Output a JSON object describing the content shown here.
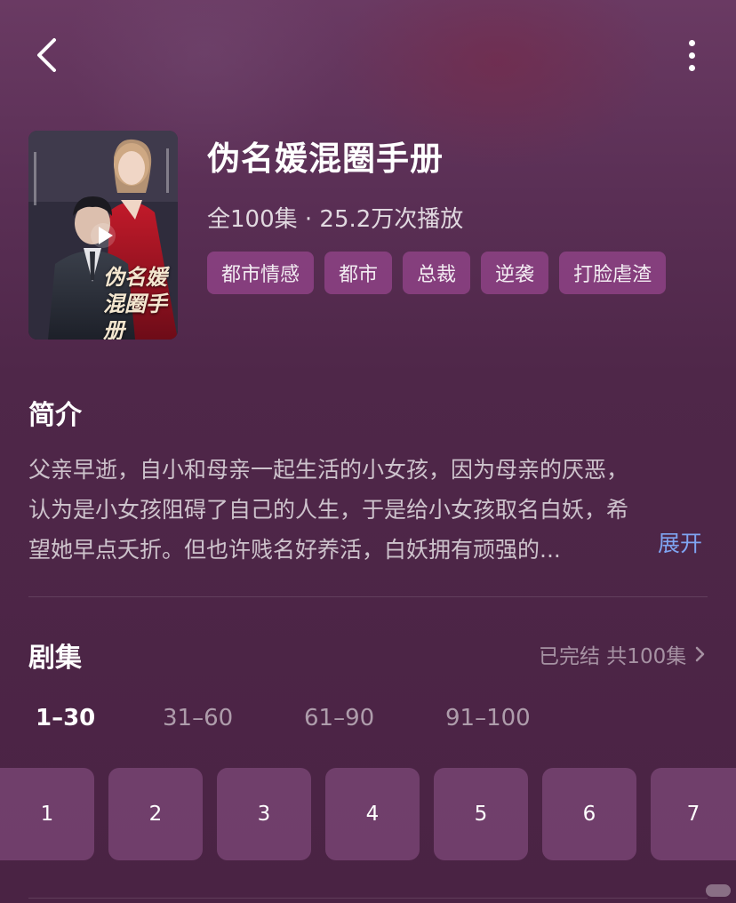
{
  "header": {
    "back_icon": "chevron-left-icon",
    "more_icon": "more-vertical-icon"
  },
  "drama": {
    "poster_title": "伪名媛混圈手册",
    "title": "伪名媛混圈手册",
    "meta": "全100集 · 25.2万次播放",
    "tags": [
      "都市情感",
      "都市",
      "总裁",
      "逆袭",
      "打脸虐渣"
    ]
  },
  "intro": {
    "heading": "简介",
    "lines": [
      "父亲早逝，自小和母亲一起生活的小女孩，因为母亲的厌恶，",
      "认为是小女孩阻碍了自己的人生，于是给小女孩取名白妖，希",
      "望她早点夭折。但也许贱名好养活，白妖拥有顽强的..."
    ],
    "expand_label": "展开",
    "expand_color": "#7fa5f2"
  },
  "episodes": {
    "heading": "剧集",
    "status": "已完结 共100集",
    "ranges": [
      "1–30",
      "31–60",
      "61–90",
      "91–100"
    ],
    "active_range": "1–30",
    "items": [
      "1",
      "2",
      "3",
      "4",
      "5",
      "6",
      "7"
    ]
  },
  "colors": {
    "background": "#4a2344",
    "tag_bg": "#96468c",
    "accent_link": "#7fa5f2"
  }
}
